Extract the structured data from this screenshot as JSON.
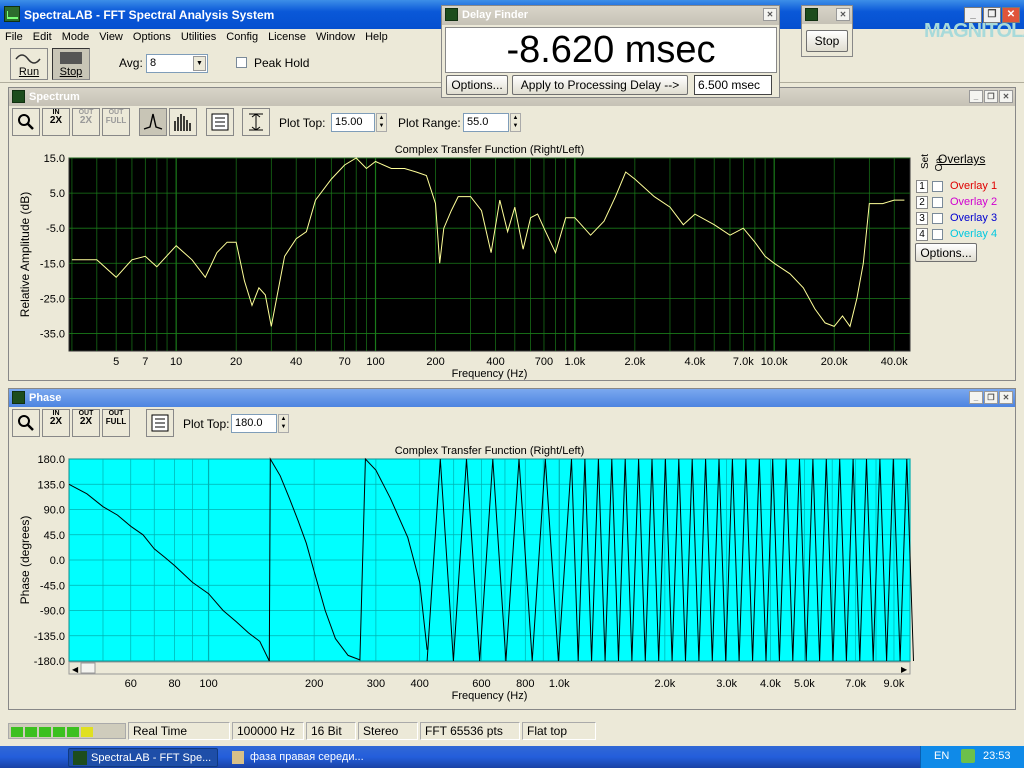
{
  "app": {
    "title": "SpectraLAB - FFT Spectral Analysis System"
  },
  "menu": [
    "File",
    "Edit",
    "Mode",
    "View",
    "Options",
    "Utilities",
    "Config",
    "License",
    "Window",
    "Help"
  ],
  "toolbar": {
    "run_label": "Run",
    "stop_label": "Stop",
    "avg_label": "Avg:",
    "avg_value": "8",
    "peak_hold_label": "Peak Hold"
  },
  "delay_finder": {
    "title": "Delay Finder",
    "readout": "-8.620 msec",
    "options_label": "Options...",
    "apply_label": "Apply to Processing Delay -->",
    "delay_value": "6.500 msec"
  },
  "stop_window": {
    "stop_label": "Stop"
  },
  "watermark": "MAGNITOLA",
  "spectrum": {
    "title": "Spectrum",
    "plot_top_label": "Plot Top:",
    "plot_top_value": "15.00",
    "plot_range_label": "Plot Range:",
    "plot_range_value": "55.0",
    "toolbar_buttons": [
      {
        "top": "IN",
        "bottom": "2X"
      },
      {
        "top": "OUT",
        "bottom": "2X"
      },
      {
        "top": "OUT",
        "bottom": "FULL"
      }
    ],
    "overlays": {
      "header": "Overlays",
      "set_label": "Set",
      "on_label": "On",
      "options_label": "Options...",
      "items": [
        {
          "num": "1",
          "label": "Overlay 1",
          "color": "#e00000"
        },
        {
          "num": "2",
          "label": "Overlay 2",
          "color": "#d000d0"
        },
        {
          "num": "3",
          "label": "Overlay 3",
          "color": "#0000d0"
        },
        {
          "num": "4",
          "label": "Overlay 4",
          "color": "#00c8e0"
        }
      ]
    }
  },
  "phase": {
    "title": "Phase",
    "plot_top_label": "Plot Top:",
    "plot_top_value": "180.0",
    "toolbar_buttons": [
      {
        "top": "IN",
        "bottom": "2X"
      },
      {
        "top": "OUT",
        "bottom": "2X"
      },
      {
        "top": "OUT",
        "bottom": "FULL"
      }
    ]
  },
  "chart_data": [
    {
      "type": "line",
      "title": "Complex Transfer Function (Right/Left)",
      "xlabel": "Frequency (Hz)",
      "ylabel": "Relative Amplitude (dB)",
      "xscale": "log",
      "xlim": [
        2.9,
        48000
      ],
      "ylim": [
        -40,
        15
      ],
      "yticks": [
        15.0,
        5.0,
        -5.0,
        -15.0,
        -25.0,
        -35.0
      ],
      "ytick_labels": [
        "15.0",
        "5.0",
        "-5.0",
        "-15.0",
        "-25.0",
        "-35.0"
      ],
      "xticks": [
        5,
        7,
        10,
        20,
        40,
        70,
        100,
        200,
        400,
        700,
        1000,
        2000,
        4000,
        7000,
        10000,
        20000,
        40000
      ],
      "xtick_labels": [
        "5",
        "7",
        "10",
        "20",
        "40",
        "70",
        "100",
        "200",
        "400",
        "700",
        "1.0k",
        "2.0k",
        "4.0k",
        "7.0k",
        "10.0k",
        "20.0k",
        "40.0k"
      ],
      "background": "#000000",
      "grid": true,
      "grid_color": "#1a7a1a",
      "line_color": "#ffff99",
      "x": [
        3,
        4,
        5,
        6,
        7,
        8,
        10,
        12,
        14,
        16,
        18,
        20,
        22,
        24,
        26,
        28,
        30,
        35,
        40,
        45,
        50,
        60,
        70,
        80,
        90,
        100,
        120,
        140,
        160,
        180,
        200,
        210,
        220,
        240,
        260,
        300,
        340,
        380,
        420,
        460,
        500,
        550,
        600,
        650,
        700,
        800,
        900,
        1000,
        1200,
        1400,
        1600,
        1800,
        2000,
        2500,
        3000,
        3500,
        4000,
        5000,
        6000,
        7000,
        8000,
        9000,
        10000,
        12000,
        14000,
        16000,
        18000,
        20000,
        22000,
        24000,
        26000,
        28000,
        30000,
        35000,
        40000,
        45000
      ],
      "y": [
        -14,
        -14,
        -19,
        -14,
        -13,
        -16,
        -10,
        -14,
        -19,
        -12,
        -9,
        -9,
        -20,
        -27,
        -22,
        -24,
        -33,
        -13,
        -8,
        -6,
        3,
        9,
        13,
        15,
        12,
        14,
        12,
        12,
        11,
        10,
        2,
        -15,
        -5,
        0,
        4,
        4,
        0,
        -12,
        3,
        -6,
        1,
        -11,
        -2,
        -1,
        -5,
        -12,
        -2,
        -2,
        -7,
        -3,
        4,
        11,
        9,
        4,
        1,
        -4,
        -1,
        -4,
        -7,
        -5,
        -9,
        -13,
        -15,
        -18,
        -22,
        -28,
        -32,
        -33,
        -30,
        -33,
        -25,
        -15,
        2,
        2,
        3,
        3
      ]
    },
    {
      "type": "line",
      "title": "Complex Transfer Function (Right/Left)",
      "xlabel": "Frequency (Hz)",
      "ylabel": "Phase (degrees)",
      "xscale": "log",
      "xlim": [
        40,
        10000
      ],
      "ylim": [
        -180,
        180
      ],
      "yticks": [
        180,
        135,
        90,
        45,
        0,
        -45,
        -90,
        -135,
        -180
      ],
      "ytick_labels": [
        "180.0",
        "135.0",
        "90.0",
        "45.0",
        "0.0",
        "-45.0",
        "-90.0",
        "-135.0",
        "-180.0"
      ],
      "xticks": [
        60,
        80,
        100,
        200,
        300,
        400,
        600,
        800,
        1000,
        2000,
        3000,
        4000,
        5000,
        7000,
        9000
      ],
      "xtick_labels": [
        "60",
        "80",
        "100",
        "200",
        "300",
        "400",
        "600",
        "800",
        "1.0k",
        "2.0k",
        "3.0k",
        "4.0k",
        "5.0k",
        "7.0k",
        "9.0k"
      ],
      "background": "#00ffff",
      "grid": true,
      "grid_color": "#00b0b0",
      "line_color": "#000000",
      "x": [
        40,
        45,
        50,
        55,
        60,
        65,
        70,
        75,
        80,
        90,
        100,
        110,
        120,
        130,
        140,
        149,
        150,
        160,
        170,
        180,
        190,
        200,
        215,
        230,
        250,
        270,
        280,
        300,
        330,
        370,
        400,
        420
      ],
      "y": [
        135,
        118,
        95,
        80,
        60,
        45,
        20,
        5,
        -10,
        -40,
        -60,
        -90,
        -110,
        -130,
        -145,
        -180,
        180,
        150,
        110,
        70,
        30,
        -20,
        -90,
        -140,
        -170,
        -178,
        180,
        160,
        110,
        40,
        -40,
        -160
      ],
      "note_dense": "phase wraps rapidly above ~420 Hz"
    }
  ],
  "status": [
    "Real Time",
    "100000 Hz",
    "16 Bit",
    "Stereo",
    "FFT 65536 pts",
    "Flat top"
  ],
  "taskbar": {
    "task1": "SpectraLAB - FFT Spe...",
    "task2": "фаза правая середи...",
    "lang": "EN",
    "clock": "23:53"
  }
}
